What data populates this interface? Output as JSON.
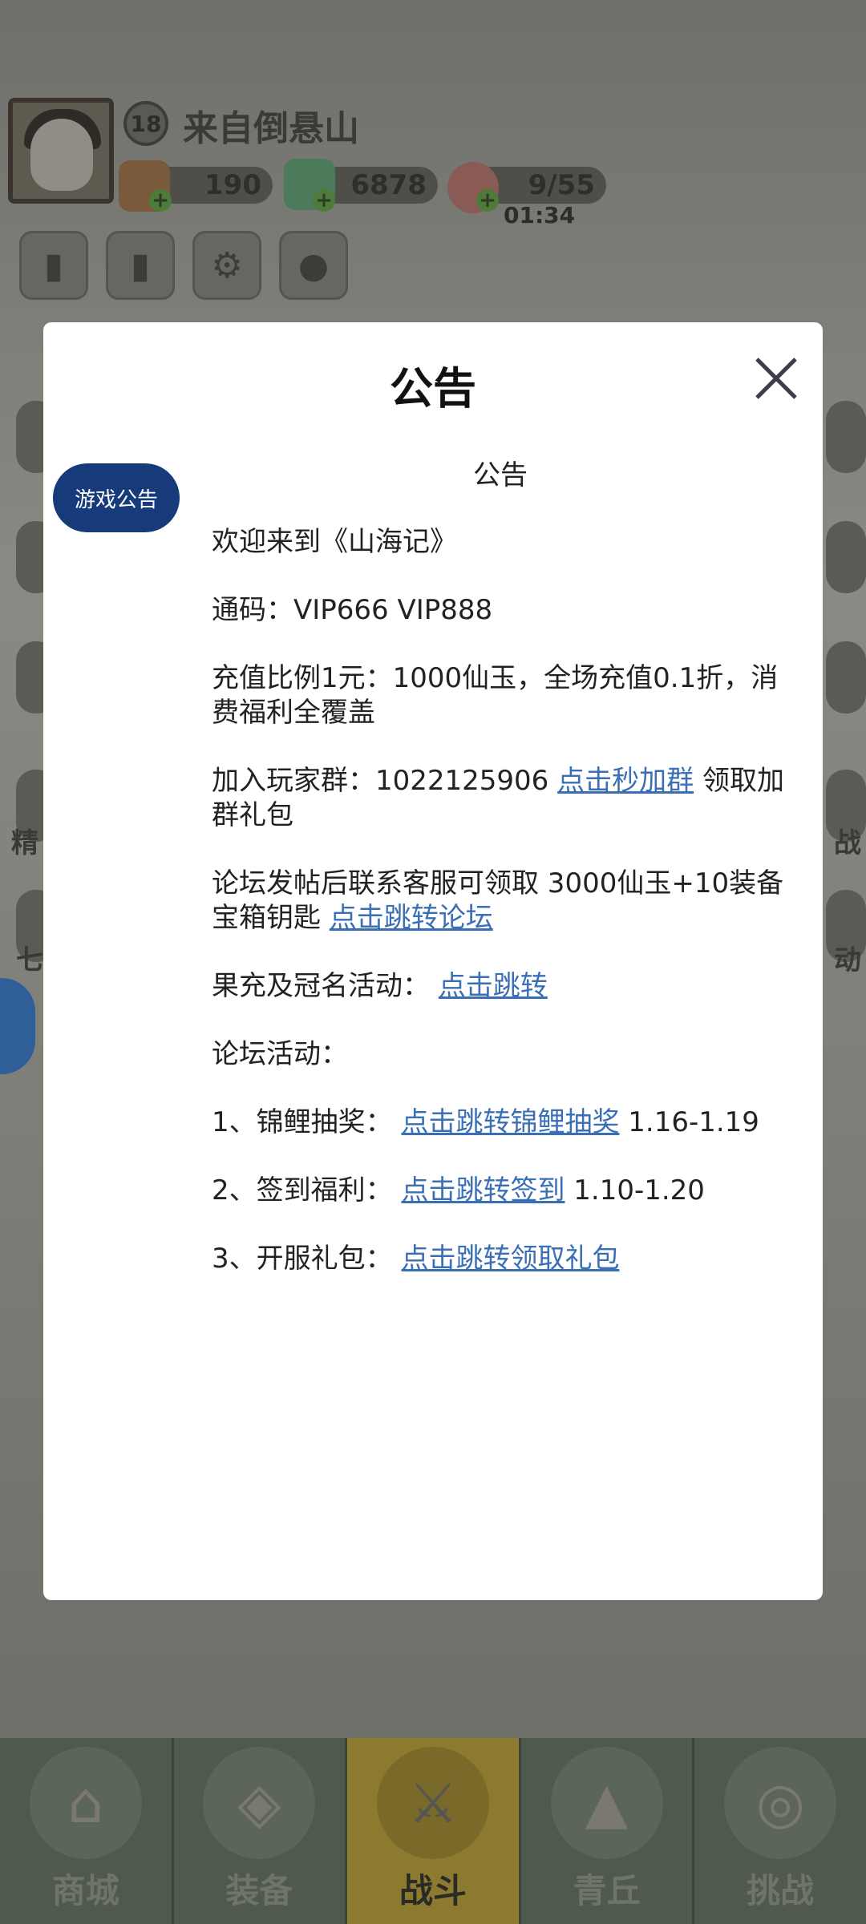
{
  "player": {
    "name": "来自倒悬山",
    "level": "18"
  },
  "resources": {
    "gold": "190",
    "jade": "6878",
    "stamina": "9/55",
    "timer": "01:34"
  },
  "side_labels": {
    "left_1": "精",
    "left_2": "七",
    "right_1": "战",
    "right_2": "动"
  },
  "bottom_nav": [
    {
      "label": "商城"
    },
    {
      "label": "装备"
    },
    {
      "label": "战斗"
    },
    {
      "label": "青丘"
    },
    {
      "label": "挑战"
    }
  ],
  "modal": {
    "title": "公告",
    "tab_label": "游戏公告",
    "content_title": "公告",
    "p1": "欢迎来到《山海记》",
    "p2": "通码：VIP666 VIP888",
    "p3": "充值比例1元：1000仙玉，全场充值0.1折，消费福利全覆盖",
    "p4_text": "加入玩家群：1022125906 ",
    "p4_link": "点击秒加群",
    "p4_tail": " 领取加群礼包",
    "p5_text": "论坛发帖后联系客服可领取 3000仙玉+10装备宝箱钥匙 ",
    "p5_link": "点击跳转论坛",
    "p6_text": "果充及冠名活动： ",
    "p6_link": "点击跳转",
    "p7": "论坛活动：",
    "p8_text": "1、锦鲤抽奖： ",
    "p8_link": "点击跳转锦鲤抽奖",
    "p8_tail": " 1.16-1.19",
    "p9_text": "2、签到福利： ",
    "p9_link": "点击跳转签到",
    "p9_tail": " 1.10-1.20",
    "p10_text": "3、开服礼包： ",
    "p10_link": "点击跳转领取礼包"
  }
}
